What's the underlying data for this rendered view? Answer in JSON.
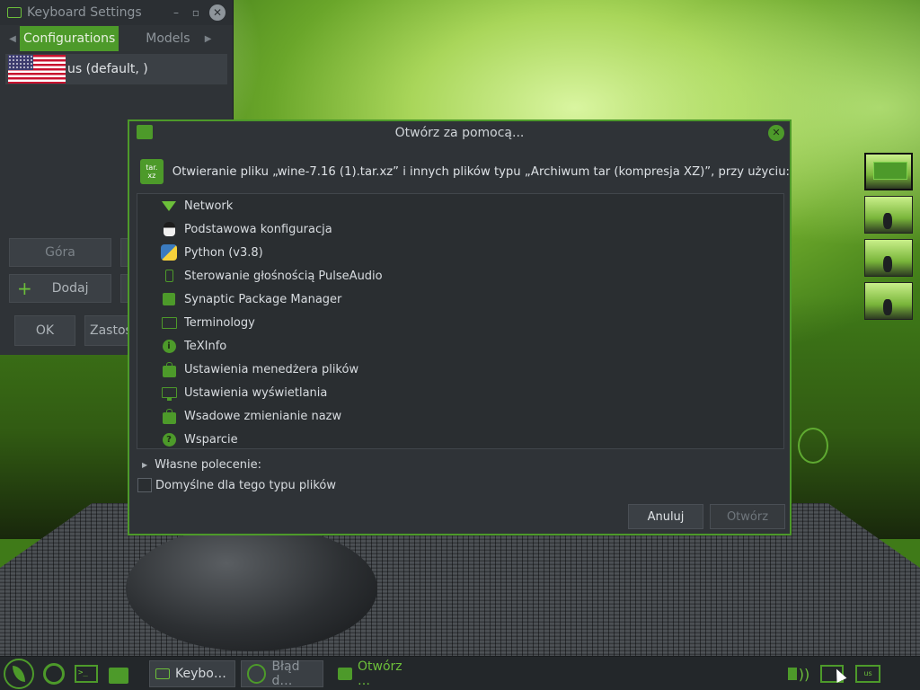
{
  "keyboard_window": {
    "title": "Keyboard Settings",
    "minimize_glyph": "–",
    "restore_glyph": "▫",
    "close_glyph": "✕",
    "tabs": {
      "left_arrow": "◀",
      "right_arrow": "▶",
      "configurations": "Configurations",
      "models": "Models"
    },
    "layouts": [
      {
        "flag": "us-flag",
        "label": "us (default, )"
      }
    ],
    "buttons": {
      "up": "Góra",
      "add": "Dodaj",
      "add_glyph": "+",
      "ok": "OK",
      "apply": "Zastos"
    }
  },
  "dialog": {
    "title": "Otwórz za pomocą...",
    "close_glyph": "✕",
    "file_icon_text": "tar.\nxz",
    "message": "Otwieranie pliku „wine-7.16 (1).tar.xz” i innych plików typu „Archiwum tar (kompresja XZ)”, przy użyciu:",
    "apps": [
      {
        "label": "Network",
        "icon": "network-icon"
      },
      {
        "label": "Podstawowa konfiguracja",
        "icon": "tux-icon"
      },
      {
        "label": "Python (v3.8)",
        "icon": "python-icon"
      },
      {
        "label": "Sterowanie głośnością PulseAudio",
        "icon": "speaker-icon"
      },
      {
        "label": "Synaptic Package Manager",
        "icon": "synaptic-icon"
      },
      {
        "label": "Terminology",
        "icon": "terminal-icon"
      },
      {
        "label": "TeXInfo",
        "icon": "info-icon"
      },
      {
        "label": "Ustawienia menedżera plików",
        "icon": "file-manager-icon"
      },
      {
        "label": "Ustawienia wyświetlania",
        "icon": "monitor-icon"
      },
      {
        "label": "Wsadowe zmienianie nazw",
        "icon": "bag-icon"
      },
      {
        "label": "Wsparcie",
        "icon": "help-icon"
      }
    ],
    "info_glyph": "i",
    "help_glyph": "?",
    "custom_command": "Własne polecenie:",
    "expander_glyph": "▶",
    "default_checkbox": "Domyślne dla tego typu plików",
    "default_checked": false,
    "cancel": "Anuluj",
    "open": "Otwórz"
  },
  "taskbar": {
    "terminal_glyph": ">_",
    "tasks": {
      "keyboard": "Keybo…",
      "error": "Błąd d…",
      "open_with": "Otwórz …"
    },
    "volume_glyph": "))",
    "layout_indicator": "us"
  },
  "colors": {
    "accent": "#4d9a2a",
    "accent_light": "#6cbf3a",
    "window_bg": "#2f3337",
    "list_bg": "#2a2e31"
  }
}
